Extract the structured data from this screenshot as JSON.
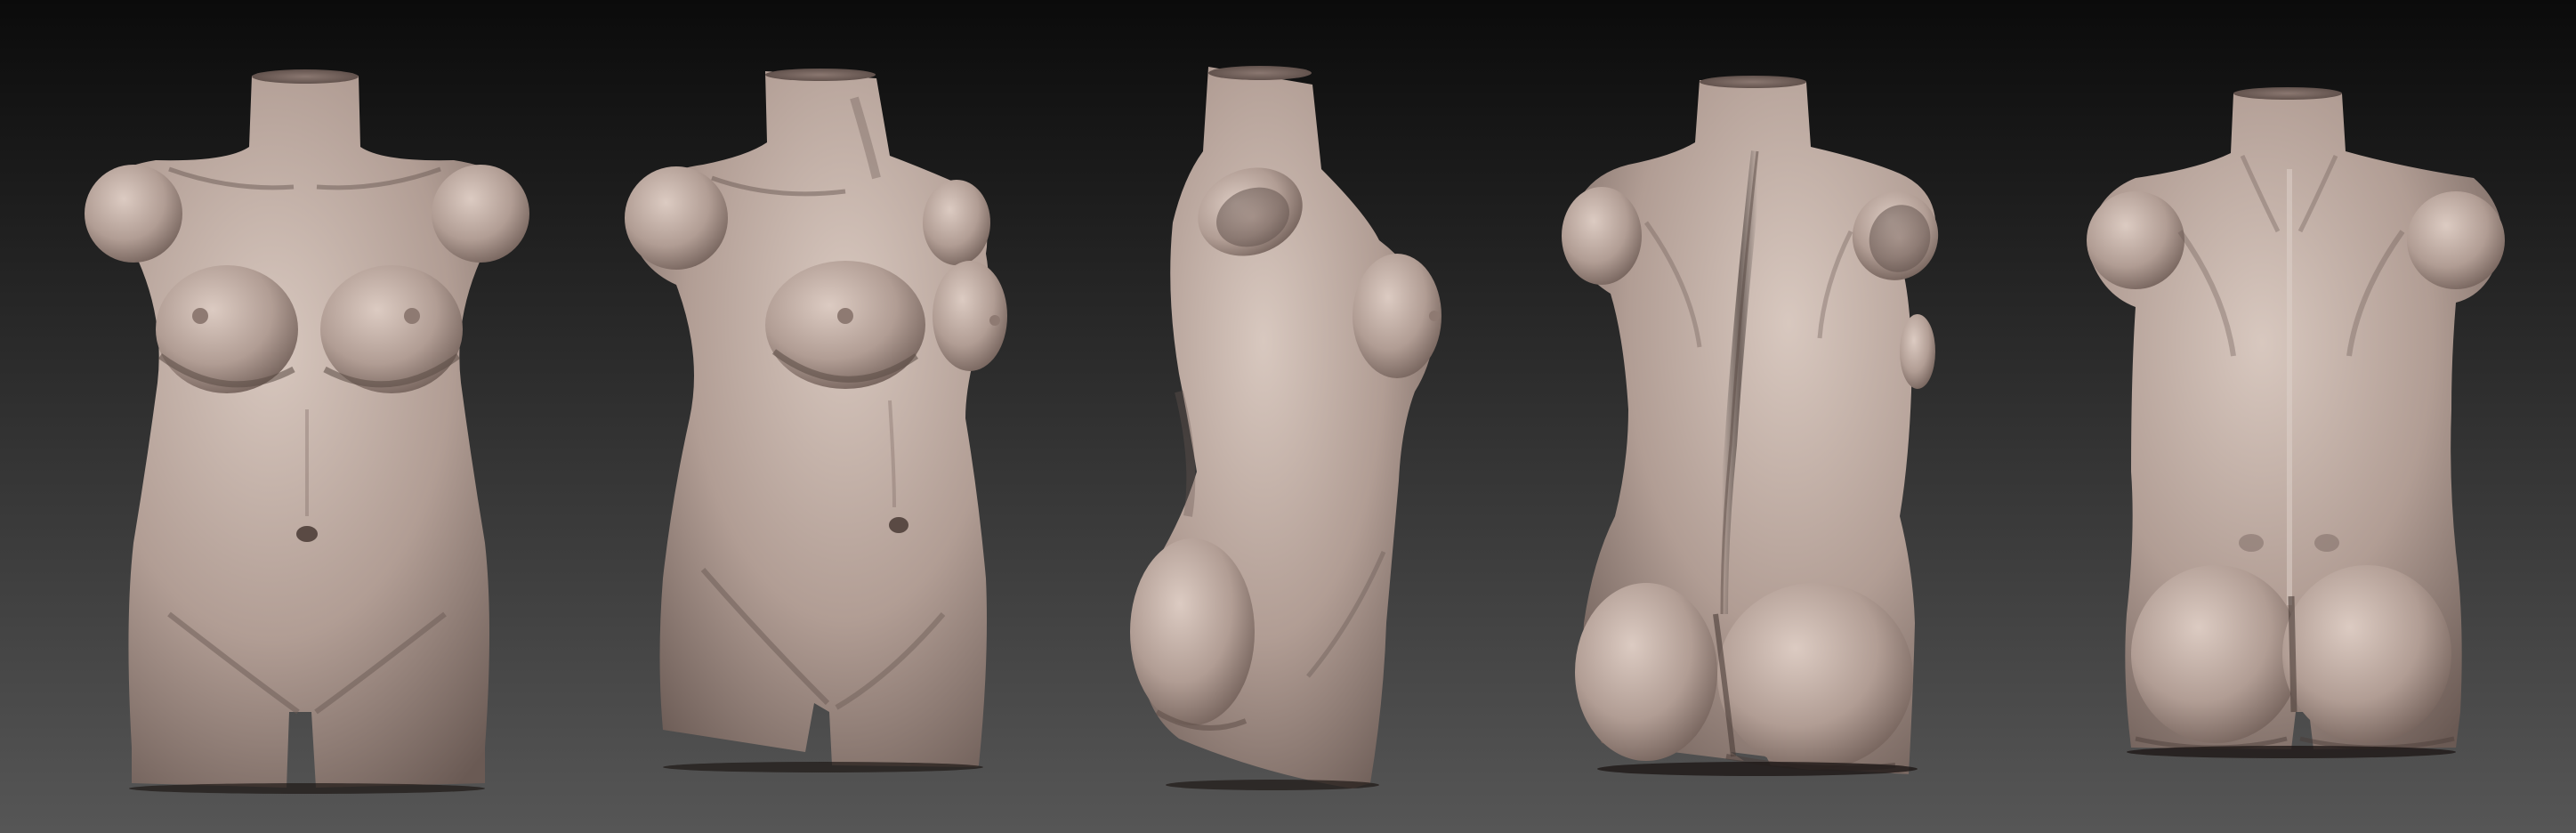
{
  "scene": {
    "background": {
      "top": "#0b0b0b",
      "bottom": "#565656"
    },
    "material": {
      "base": "#b19d94",
      "light": "#d8c8bf",
      "shadow": "#6a5a54",
      "deep": "#3c302c"
    },
    "views": [
      {
        "name": "front"
      },
      {
        "name": "three-quarter-front"
      },
      {
        "name": "side"
      },
      {
        "name": "three-quarter-back"
      },
      {
        "name": "back"
      }
    ]
  }
}
